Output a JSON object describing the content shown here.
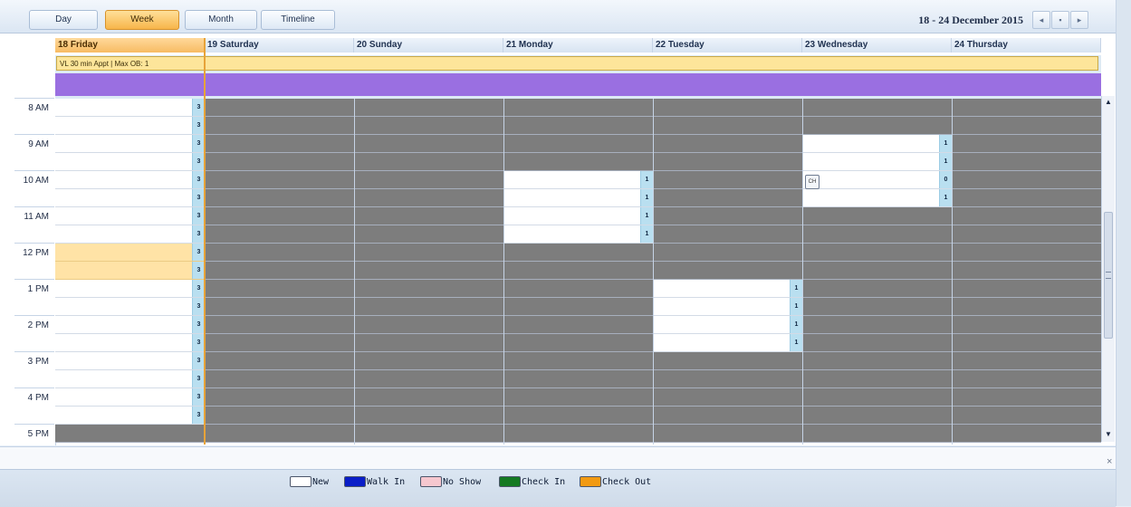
{
  "toolbar": {
    "views": [
      {
        "label": "Day",
        "active": false
      },
      {
        "label": "Week",
        "active": true
      },
      {
        "label": "Month",
        "active": false
      },
      {
        "label": "Timeline",
        "active": false
      }
    ],
    "date_range": "18 - 24 December 2015",
    "nav_buttons": [
      {
        "icon": "previous-arrow",
        "glyph": "◂"
      },
      {
        "icon": "today-marker",
        "glyph": "▪"
      },
      {
        "icon": "next-arrow",
        "glyph": "▸"
      }
    ]
  },
  "days": [
    {
      "label": "18 Friday",
      "today": true
    },
    {
      "label": "19 Saturday",
      "today": false
    },
    {
      "label": "20 Sunday",
      "today": false
    },
    {
      "label": "21 Monday",
      "today": false
    },
    {
      "label": "22 Tuesday",
      "today": false
    },
    {
      "label": "23 Wednesday",
      "today": false
    },
    {
      "label": "24 Thursday",
      "today": false
    }
  ],
  "all_day_appointment": "VL 30 min Appt | Max OB: 1",
  "hours": [
    "8 AM",
    "9 AM",
    "10 AM",
    "11 AM",
    "12 PM",
    "1 PM",
    "2 PM",
    "3 PM",
    "4 PM",
    "5 PM"
  ],
  "slot_rows": 19,
  "open_slots": [
    {
      "day": 0,
      "from": 0,
      "to": 17,
      "count": "3",
      "lunch_rows": [
        8,
        9
      ]
    },
    {
      "day": 3,
      "from": 4,
      "to": 7,
      "count": "1"
    },
    {
      "day": 4,
      "from": 10,
      "to": 13,
      "count": "1"
    },
    {
      "day": 5,
      "from": 2,
      "to": 5,
      "counts": [
        "1",
        "1",
        "0",
        "1"
      ]
    }
  ],
  "booked_appointment": {
    "icon": "check-in-icon",
    "glyph": "CH"
  },
  "scrollbar": {
    "up_glyph": "▲",
    "down_glyph": "▼"
  },
  "close_glyph": "×",
  "legend": [
    {
      "label": "New",
      "color": "#ffffff"
    },
    {
      "label": "Walk In",
      "color": "#0a1ec8"
    },
    {
      "label": "No Show",
      "color": "#f6c7cf"
    },
    {
      "label": "Check In",
      "color": "#157a22"
    },
    {
      "label": "Check Out",
      "color": "#f29a13"
    }
  ],
  "colors": {
    "off_hours": "#7d7d7d",
    "working": "#ffffff",
    "lunch": "#ffe3a6",
    "all_day_band": "#9a6fe1",
    "today_accent": "#e7a339"
  }
}
